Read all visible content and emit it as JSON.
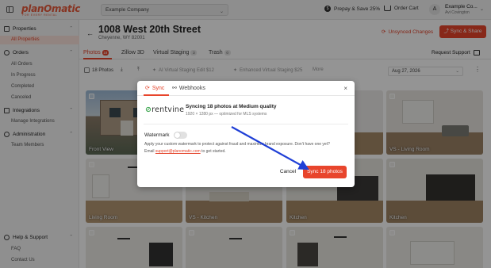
{
  "brand": {
    "logo": "planOmatic",
    "tagline": "FOR EVERY RENTAL",
    "accent": "#e8452c"
  },
  "header": {
    "company": "Example Company",
    "prepay": "Prepay & Save 25%",
    "cart": "Order Cart",
    "user_initial": "A",
    "user_name": "Example Co...",
    "user_sub": "Avi Covington"
  },
  "sidebar": {
    "sections": [
      {
        "title": "Properties",
        "items": [
          "All Properties"
        ]
      },
      {
        "title": "Orders",
        "items": [
          "All Orders",
          "In Progress",
          "Completed",
          "Canceled"
        ]
      },
      {
        "title": "Integrations",
        "items": [
          "Manage Integrations"
        ]
      },
      {
        "title": "Administration",
        "items": [
          "Team Members"
        ]
      },
      {
        "title": "Help & Support",
        "items": [
          "FAQ",
          "Contact Us"
        ]
      }
    ]
  },
  "property": {
    "address": "1008 West 20th Street",
    "city": "Cheyenne, WY 82001",
    "unsynced": "Unsynced Changes",
    "sync_share": "Sync & Share"
  },
  "tabs": [
    {
      "label": "Photos",
      "badge": "18"
    },
    {
      "label": "Zillow 3D",
      "badge": ""
    },
    {
      "label": "Virtual Staging",
      "badge": "3"
    },
    {
      "label": "Trash",
      "badge": "0"
    }
  ],
  "request_support": "Request Support",
  "toolbar": {
    "photos_count": "18 Photos",
    "ai_staging": "AI Virtual Staging Edit $12",
    "enhanced": "Enhanced Virtual Staging $25",
    "more": "More",
    "date": "Aug 27, 2026"
  },
  "photos": [
    {
      "label": "Front View"
    },
    {
      "label": ""
    },
    {
      "label": ""
    },
    {
      "label": "VS - Living Room"
    },
    {
      "label": "Living Room"
    },
    {
      "label": "VS - Kitchen"
    },
    {
      "label": "Kitchen"
    },
    {
      "label": "Kitchen"
    },
    {
      "label": ""
    },
    {
      "label": ""
    },
    {
      "label": ""
    },
    {
      "label": ""
    }
  ],
  "dialog": {
    "tab_sync": "Sync",
    "tab_webhooks": "Webhooks",
    "partner_logo": "rentvine",
    "sync_title": "Syncing 18 photos at Medium quality",
    "sync_sub": "1920 × 1280 px — optimized for MLS systems",
    "watermark_label": "Watermark",
    "watermark_on": false,
    "watermark_desc": "Apply your custom watermark to protect against fraud and maximize brand exposure. Don't have one yet?",
    "email_prefix": "Email ",
    "email_link": "support@planomatic.com",
    "email_suffix": " to get started.",
    "cancel": "Cancel",
    "confirm": "Sync 18 photos"
  }
}
